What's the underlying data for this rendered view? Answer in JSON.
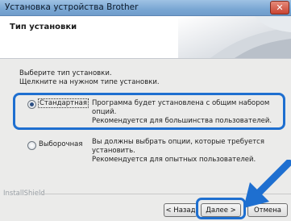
{
  "window": {
    "title": "Установка устройства Brother",
    "close_label": "✕"
  },
  "header": {
    "title": "Тип установки"
  },
  "instructions": {
    "line1": "Выберите тип установки.",
    "line2": "Щелкните на нужном типе установки."
  },
  "options": [
    {
      "label": "Стандартная",
      "selected": true,
      "desc_line1": "Программа будет установлена с общим набором опций.",
      "desc_line2": "Рекомендуется для большинства пользователей."
    },
    {
      "label": "Выборочная",
      "selected": false,
      "desc_line1": "Вы должны выбрать опции, которые требуется установить.",
      "desc_line2": "Рекомендуется для опытных пользователей."
    }
  ],
  "footer": {
    "brand": "InstallShield",
    "back_label": "< Назад",
    "next_label": "Далее >",
    "cancel_label": "Отмена"
  },
  "colors": {
    "highlight": "#1e6fd0",
    "titlebar": "#7aa7d3"
  }
}
